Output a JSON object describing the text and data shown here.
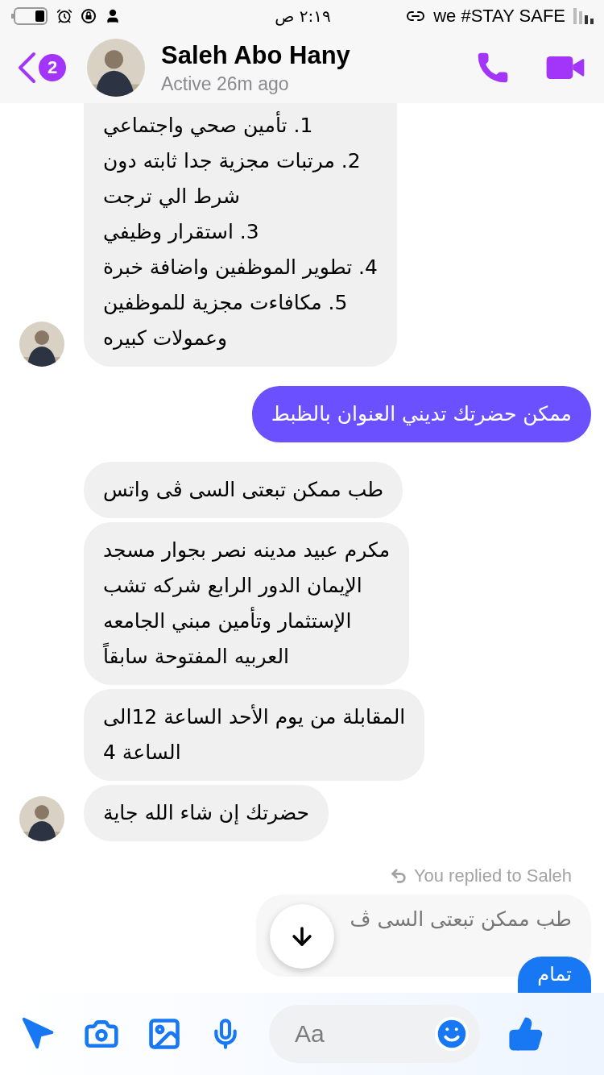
{
  "status_bar": {
    "time": "٢:١٩ ص",
    "carrier": "we #STAY SAFE"
  },
  "header": {
    "unread_count": "2",
    "name": "Saleh Abo Hany",
    "status": "Active 26m ago"
  },
  "messages": [
    {
      "kind": "received",
      "avatar": true,
      "top_cut": true,
      "text": "1.  تأمين صحي واجتماعي\n2. مرتبات مجزية جدا ثابته دون\nشرط الي ترجت\n3. استقرار وظيفي\n4. تطوير الموظفين واضافة خبرة\n5. مكافاءت مجزية للموظفين\nوعمولات كبيره"
    },
    {
      "kind": "sent",
      "avatar": false,
      "top_cut": false,
      "text": "ممكن حضرتك تديني العنوان بالظبط"
    },
    {
      "kind": "received",
      "avatar": false,
      "top_cut": false,
      "text": "طب ممكن تبعتى السى ڤى واتس"
    },
    {
      "kind": "received",
      "avatar": false,
      "top_cut": false,
      "text": "مكرم عبيد مدينه نصر بجوار مسجد\nالإيمان الدور الرابع شركه تشب\nالإستثمار وتأمين مبني الجامعه\nالعربيه المفتوحة سابقاً"
    },
    {
      "kind": "received",
      "avatar": false,
      "top_cut": false,
      "text": "المقابلة من يوم الأحد الساعة 12الى\nالساعة 4"
    },
    {
      "kind": "received",
      "avatar": true,
      "top_cut": false,
      "text": "حضرتك إن شاء الله جاية"
    }
  ],
  "reply": {
    "note": "You replied to Saleh",
    "quote": "طب ممكن تبعتى السى ڤ",
    "text": "تمام"
  },
  "composer": {
    "placeholder": "Aa"
  }
}
